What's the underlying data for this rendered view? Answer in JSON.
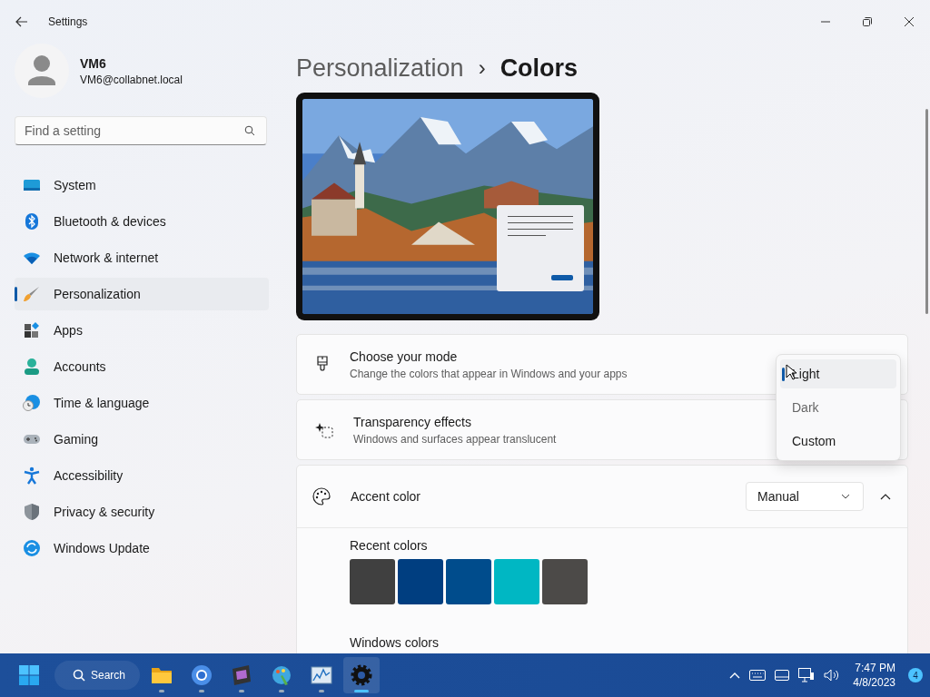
{
  "window": {
    "title": "Settings"
  },
  "user": {
    "name": "VM6",
    "email": "VM6@collabnet.local"
  },
  "search": {
    "placeholder": "Find a setting"
  },
  "nav": [
    {
      "label": "System",
      "selected": false
    },
    {
      "label": "Bluetooth & devices",
      "selected": false
    },
    {
      "label": "Network & internet",
      "selected": false
    },
    {
      "label": "Personalization",
      "selected": true
    },
    {
      "label": "Apps",
      "selected": false
    },
    {
      "label": "Accounts",
      "selected": false
    },
    {
      "label": "Time & language",
      "selected": false
    },
    {
      "label": "Gaming",
      "selected": false
    },
    {
      "label": "Accessibility",
      "selected": false
    },
    {
      "label": "Privacy & security",
      "selected": false
    },
    {
      "label": "Windows Update",
      "selected": false
    }
  ],
  "breadcrumb": {
    "parent": "Personalization",
    "separator": "›",
    "current": "Colors"
  },
  "settings": [
    {
      "kind": "mode",
      "title": "Choose your mode",
      "description": "Change the colors that appear in Windows and your apps"
    },
    {
      "kind": "transparency",
      "title": "Transparency effects",
      "description": "Windows and surfaces appear translucent"
    }
  ],
  "mode_menu": [
    {
      "label": "Light",
      "selected": true
    },
    {
      "label": "Dark",
      "selected": false
    },
    {
      "label": "Custom",
      "selected": false
    }
  ],
  "accent": {
    "title": "Accent color",
    "value": "Manual",
    "expanded": true,
    "recent_label": "Recent colors",
    "windows_label": "Windows colors"
  },
  "recent_colors": [
    {
      "color": "#404040"
    },
    {
      "color": "#003e80"
    },
    {
      "color": "#004c8c"
    },
    {
      "color": "#00b7c3"
    },
    {
      "color": "#4c4a48"
    }
  ],
  "taskbar": {
    "search": "Search",
    "apps": [
      {
        "selected": false
      },
      {
        "selected": false
      },
      {
        "selected": false
      },
      {
        "selected": false
      },
      {
        "selected": false
      },
      {
        "selected": true
      }
    ],
    "time": "7:47 PM",
    "date": "4/8/2023",
    "notifications": "4"
  }
}
